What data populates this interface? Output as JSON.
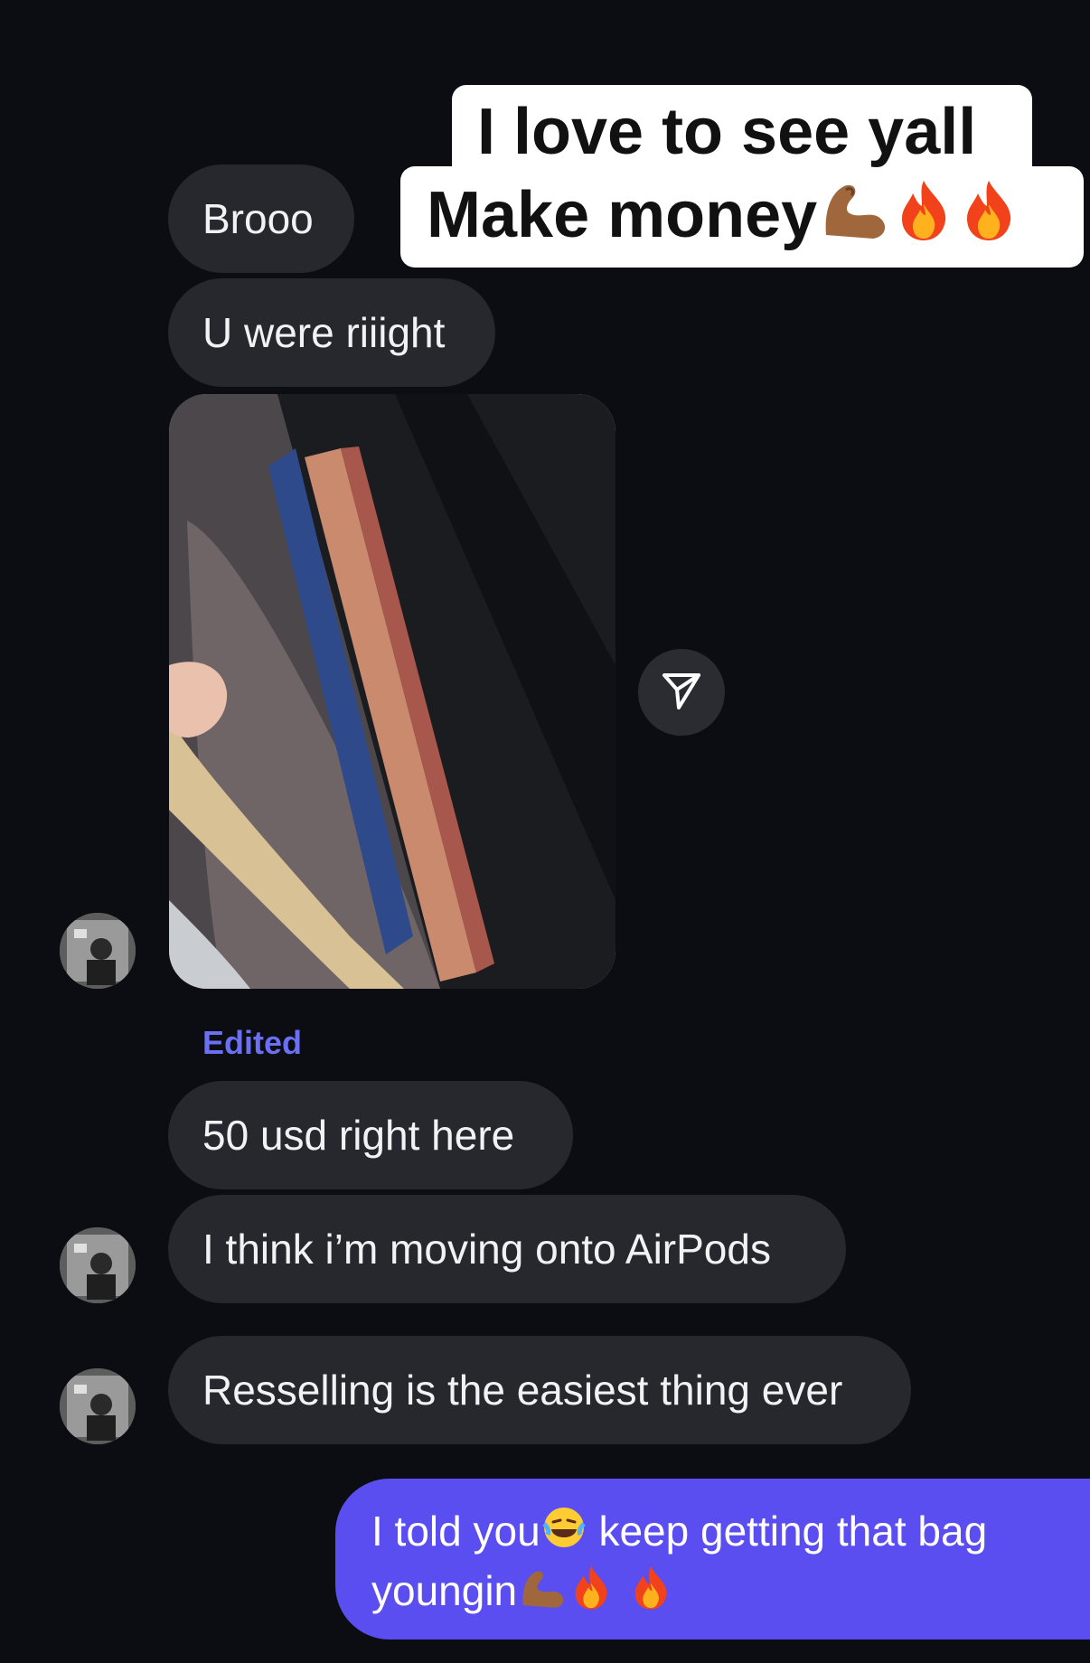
{
  "caption": {
    "line1": "I love to see yall",
    "line2_text": "Make money",
    "line2_emoji": [
      "flexed-biceps",
      "fire",
      "fire"
    ]
  },
  "messages": {
    "brooo": "Brooo",
    "riiight": "U were riiight",
    "edited_label": "Edited",
    "usd": "50 usd right here",
    "airpods": "I think i’m moving onto AirPods",
    "reselling": "Resselling is the easiest thing ever"
  },
  "sent": {
    "part1": "I told you",
    "part2": " keep getting that bag",
    "part3": "youngin",
    "emoji": [
      "face-with-tears-of-joy",
      "flexed-biceps",
      "fire",
      "fire"
    ]
  },
  "colors": {
    "background": "#0b0d13",
    "received_bubble": "#26282d",
    "sent_bubble": "#5a4ef0",
    "edited_label": "#6b70f2"
  },
  "icons": {
    "share": "paper-plane-icon",
    "avatar": "user-avatar"
  }
}
